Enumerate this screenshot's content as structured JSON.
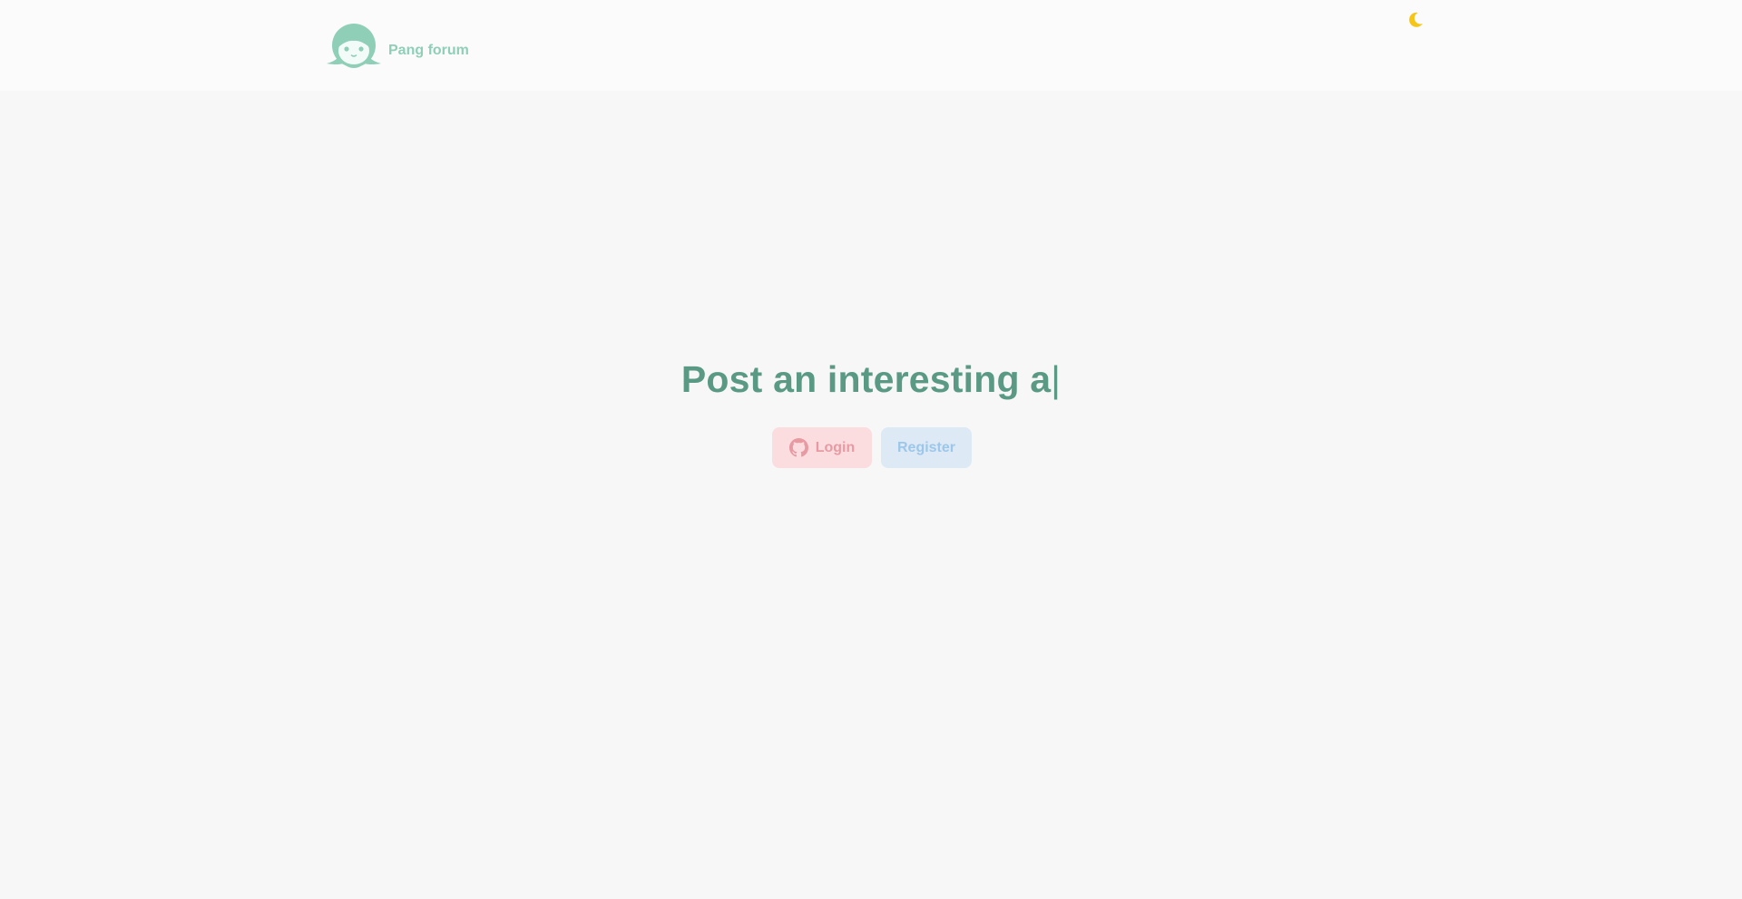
{
  "header": {
    "brand_name": "Pang forum",
    "logo_icon": "forum-mascot-logo",
    "theme_toggle_icon": "moon-icon",
    "theme_toggle_glyph": "🌙"
  },
  "hero": {
    "title": "Post an interesting a",
    "cursor": "|"
  },
  "actions": {
    "login_label": "Login",
    "login_icon": "github-icon",
    "register_label": "Register"
  },
  "colors": {
    "brand": "#8fcfb8",
    "title": "#5a9a84",
    "login_bg": "#fbdde0",
    "login_text": "#e89aa3",
    "register_bg": "#dde9f5",
    "register_text": "#9cc7ea",
    "moon": "#f5c518"
  }
}
